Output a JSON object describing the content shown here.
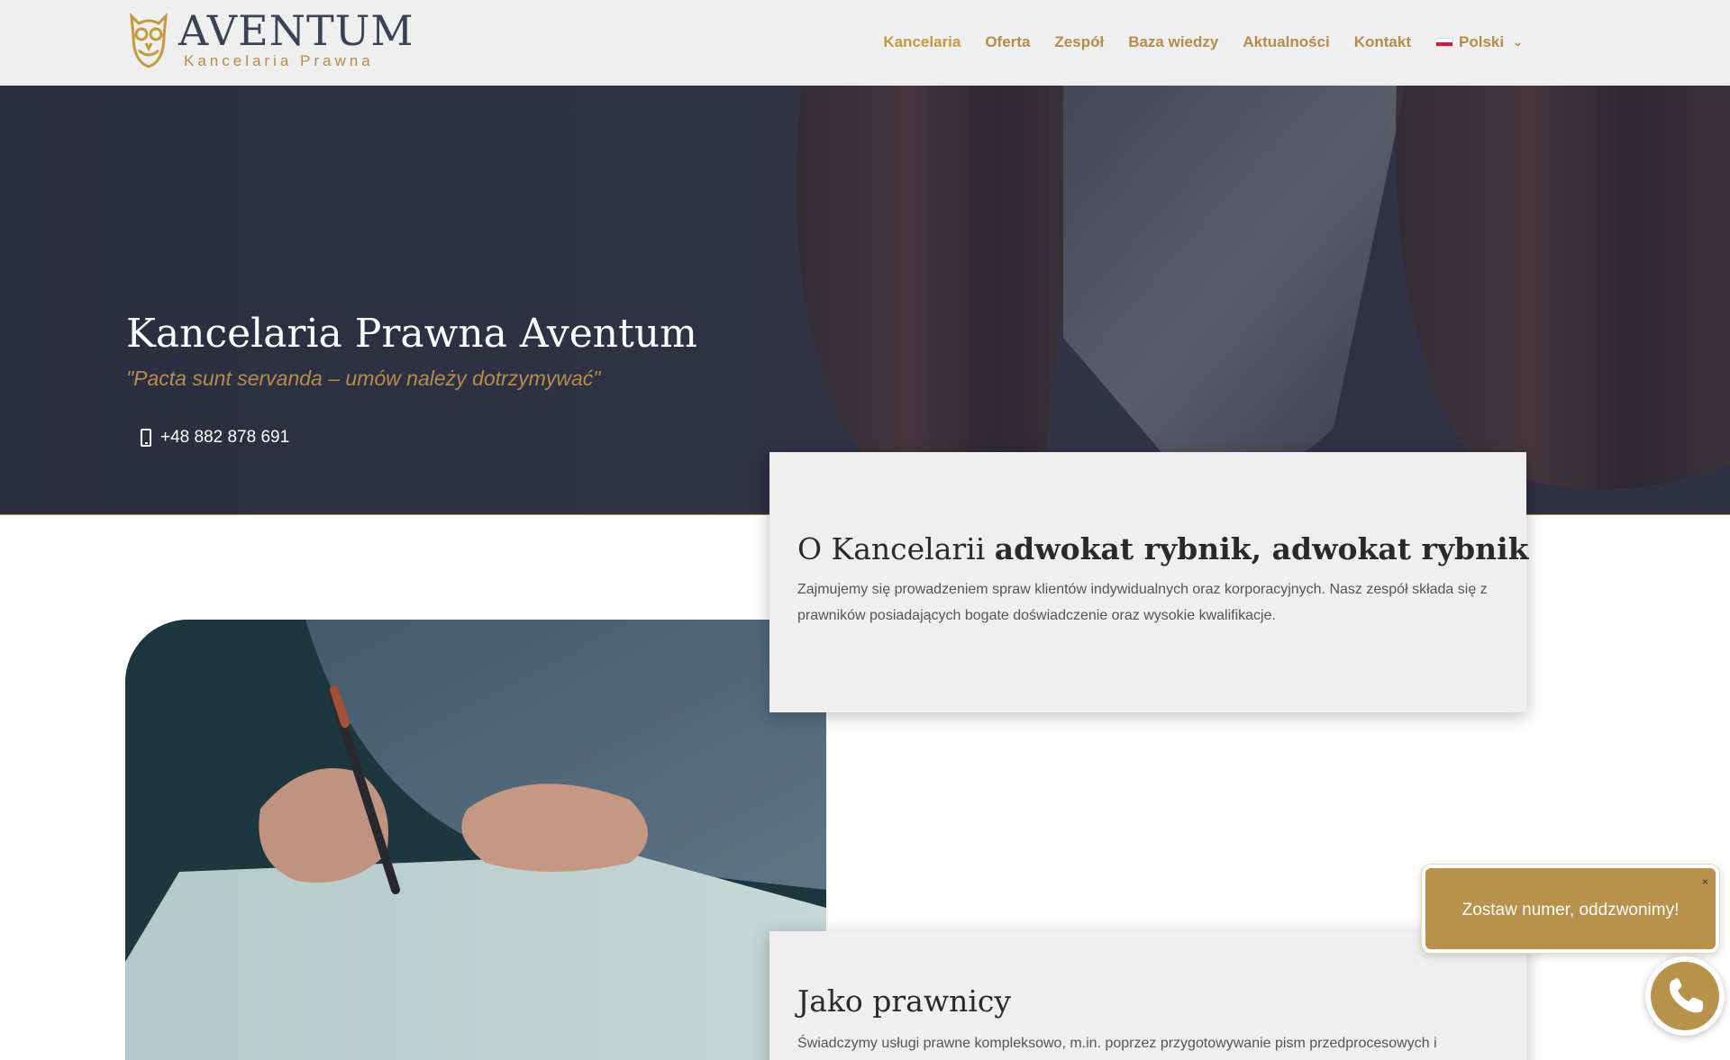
{
  "brand": {
    "name": "AVENTUM",
    "subtitle": "Kancelaria Prawna"
  },
  "nav": {
    "items": [
      {
        "label": "Kancelaria"
      },
      {
        "label": "Oferta"
      },
      {
        "label": "Zespół"
      },
      {
        "label": "Baza wiedzy"
      },
      {
        "label": "Aktualności"
      },
      {
        "label": "Kontakt"
      }
    ],
    "language": "Polski",
    "language_icon": "flag-pl-icon"
  },
  "hero": {
    "title": "Kancelaria Prawna Aventum",
    "quote": "\"Pacta sunt servanda – umów należy dotrzymywać\"",
    "phone": "+48 882 878 691"
  },
  "about": {
    "heading_light": "O Kancelarii ",
    "heading_bold": "adwokat rybnik, adwokat rybnik",
    "text": "Zajmujemy się prowadzeniem spraw klientów indywidualnych oraz korporacyjnych. Nasz zespół składa się z prawników posiadających bogate doświadczenie oraz wysokie kwalifikacje."
  },
  "lawyers": {
    "heading": "Jako prawnicy",
    "text": "Świadczymy usługi prawne kompleksowo, m.in. poprzez przygotowywanie pism przedprocesowych i"
  },
  "callback": {
    "label": "Zostaw numer, oddzwonimy!",
    "close": "×"
  },
  "colors": {
    "accent": "#b38d4a",
    "header_bg": "#efefef",
    "hero_bg": "#2f3245",
    "card_bg": "#efefef",
    "heading": "#2a2a2a"
  }
}
